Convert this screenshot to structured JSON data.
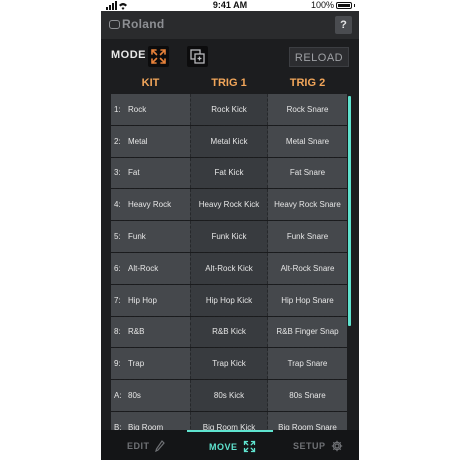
{
  "status": {
    "time": "9:41 AM",
    "battery": "100%"
  },
  "header": {
    "logo": "Roland",
    "help_label": "?"
  },
  "mode": {
    "label": "MODE",
    "reload_label": "RELOAD"
  },
  "columns": [
    "KIT",
    "TRIG 1",
    "TRIG 2"
  ],
  "rows": [
    {
      "num": "1:",
      "kit": "Rock",
      "trig1": "Rock Kick",
      "trig2": "Rock Snare"
    },
    {
      "num": "2:",
      "kit": "Metal",
      "trig1": "Metal Kick",
      "trig2": "Metal Snare"
    },
    {
      "num": "3:",
      "kit": "Fat",
      "trig1": "Fat Kick",
      "trig2": "Fat Snare"
    },
    {
      "num": "4:",
      "kit": "Heavy Rock",
      "trig1": "Heavy Rock Kick",
      "trig2": "Heavy Rock Snare"
    },
    {
      "num": "5:",
      "kit": "Funk",
      "trig1": "Funk Kick",
      "trig2": "Funk Snare"
    },
    {
      "num": "6:",
      "kit": "Alt-Rock",
      "trig1": "Alt-Rock Kick",
      "trig2": "Alt-Rock Snare"
    },
    {
      "num": "7:",
      "kit": "Hip Hop",
      "trig1": "Hip Hop Kick",
      "trig2": "Hip Hop Snare"
    },
    {
      "num": "8:",
      "kit": "R&B",
      "trig1": "R&B Kick",
      "trig2": "R&B Finger Snap"
    },
    {
      "num": "9:",
      "kit": "Trap",
      "trig1": "Trap Kick",
      "trig2": "Trap Snare"
    },
    {
      "num": "A:",
      "kit": "80s",
      "trig1": "80s Kick",
      "trig2": "80s Snare"
    },
    {
      "num": "B:",
      "kit": "Big Room",
      "trig1": "Big Room Kick",
      "trig2": "Big Room Snare"
    }
  ],
  "tabs": {
    "edit": "EDIT",
    "move": "MOVE",
    "setup": "SETUP"
  },
  "colors": {
    "accent": "#5fe3cf",
    "header_orange": "#f2a65a",
    "mode_icon_orange": "#e8823a"
  }
}
